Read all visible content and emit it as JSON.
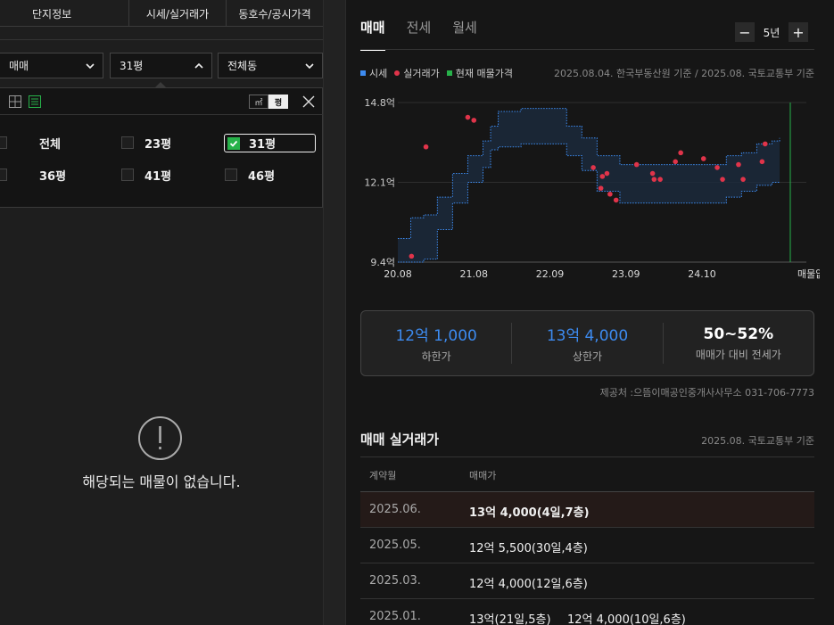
{
  "left": {
    "tabs": [
      "단지정보",
      "시세/실거래가",
      "동호수/공시가격"
    ],
    "dropdowns": {
      "trade_type": "매매",
      "area": "31평",
      "dong": "전체동"
    },
    "unit_toggle": {
      "m2": "㎡",
      "pyeong": "평"
    },
    "areas": [
      {
        "label": "전체",
        "selected": false
      },
      {
        "label": "23평",
        "selected": false
      },
      {
        "label": "31평",
        "selected": true
      },
      {
        "label": "36평",
        "selected": false
      },
      {
        "label": "41평",
        "selected": false
      },
      {
        "label": "46평",
        "selected": false
      }
    ],
    "empty_message": "해당되는 매물이 없습니다."
  },
  "right": {
    "tabs": [
      "매매",
      "전세",
      "월세"
    ],
    "active_tab": "매매",
    "period": {
      "minus": "−",
      "value": "5년",
      "plus": "+"
    },
    "legend": [
      {
        "label": "시세",
        "color": "#3d8bf0"
      },
      {
        "label": "실거래가",
        "color": "#e0344a"
      },
      {
        "label": "현재 매물가격",
        "color": "#27b24a"
      }
    ],
    "source_note": "2025.08.04. 한국부동산원 기준 / 2025.08. 국토교통부 기준",
    "summary": [
      {
        "value": "12억 1,000",
        "label": "하한가"
      },
      {
        "value": "13억 4,000",
        "label": "상한가"
      },
      {
        "value": "50~52%",
        "label": "매매가 대비 전세가"
      }
    ],
    "provider": "제공처 :으뜸이매공인중개사사무소 031-706-7773",
    "transactions": {
      "title": "매매 실거래가",
      "source": "2025.08. 국토교통부 기준",
      "headers": [
        "계약월",
        "매매가"
      ],
      "rows": [
        {
          "date": "2025.06.",
          "price": "13억 4,000(4일,7층)",
          "price2": ""
        },
        {
          "date": "2025.05.",
          "price": "12억 5,500(30일,4층)",
          "price2": ""
        },
        {
          "date": "2025.03.",
          "price": "12억 4,000(12일,6층)",
          "price2": ""
        },
        {
          "date": "2025.01.",
          "price": "13억(21일,5층)",
          "price2": "12억 4,000(10일,6층)"
        }
      ]
    }
  },
  "chart_data": {
    "type": "area",
    "y_unit": "억",
    "ylim": [
      9.4,
      14.8
    ],
    "y_ticks": [
      "9.4억",
      "12.1억",
      "14.8억"
    ],
    "x_ticks": [
      "20.08",
      "21.08",
      "22.09",
      "23.09",
      "24.10"
    ],
    "x_end_label": "매물없음",
    "series": [
      {
        "name": "시세",
        "color": "#3d8bf0",
        "x": [
          2020.58,
          2020.75,
          2020.92,
          2021.1,
          2021.3,
          2021.5,
          2021.7,
          2021.8,
          2021.9,
          2022.2,
          2022.5,
          2022.8,
          2023.0,
          2023.2,
          2023.5,
          2023.8,
          2024.0,
          2024.3,
          2024.6,
          2024.9,
          2025.1,
          2025.3,
          2025.5,
          2025.6
        ],
        "upper": [
          10.2,
          10.9,
          11.0,
          11.6,
          12.4,
          13.0,
          13.5,
          14.0,
          14.5,
          14.6,
          14.6,
          14.0,
          13.6,
          13.0,
          12.7,
          12.7,
          12.7,
          12.7,
          12.7,
          13.0,
          13.1,
          13.4,
          13.5,
          13.6
        ],
        "lower": [
          9.4,
          9.4,
          9.5,
          10.5,
          11.4,
          12.1,
          12.6,
          13.2,
          13.3,
          13.4,
          13.4,
          13.0,
          12.5,
          11.8,
          11.4,
          11.4,
          11.4,
          11.4,
          11.4,
          11.6,
          11.8,
          12.0,
          12.1,
          12.1
        ]
      }
    ],
    "points": [
      {
        "x": 2020.76,
        "y": 9.6
      },
      {
        "x": 2020.95,
        "y": 13.3
      },
      {
        "x": 2021.5,
        "y": 14.3
      },
      {
        "x": 2021.58,
        "y": 14.2
      },
      {
        "x": 2023.15,
        "y": 12.6
      },
      {
        "x": 2023.25,
        "y": 11.9
      },
      {
        "x": 2023.27,
        "y": 12.3
      },
      {
        "x": 2023.33,
        "y": 12.4
      },
      {
        "x": 2023.37,
        "y": 11.7
      },
      {
        "x": 2023.45,
        "y": 11.5
      },
      {
        "x": 2023.72,
        "y": 12.7
      },
      {
        "x": 2023.93,
        "y": 12.4
      },
      {
        "x": 2023.95,
        "y": 12.2
      },
      {
        "x": 2024.03,
        "y": 12.2
      },
      {
        "x": 2024.23,
        "y": 12.8
      },
      {
        "x": 2024.3,
        "y": 13.1
      },
      {
        "x": 2024.6,
        "y": 12.9
      },
      {
        "x": 2024.78,
        "y": 12.6
      },
      {
        "x": 2024.85,
        "y": 12.2
      },
      {
        "x": 2025.06,
        "y": 12.7
      },
      {
        "x": 2025.12,
        "y": 12.2
      },
      {
        "x": 2025.37,
        "y": 12.8
      },
      {
        "x": 2025.41,
        "y": 13.4
      }
    ],
    "current_listing_x": 2025.6,
    "grid": true
  }
}
